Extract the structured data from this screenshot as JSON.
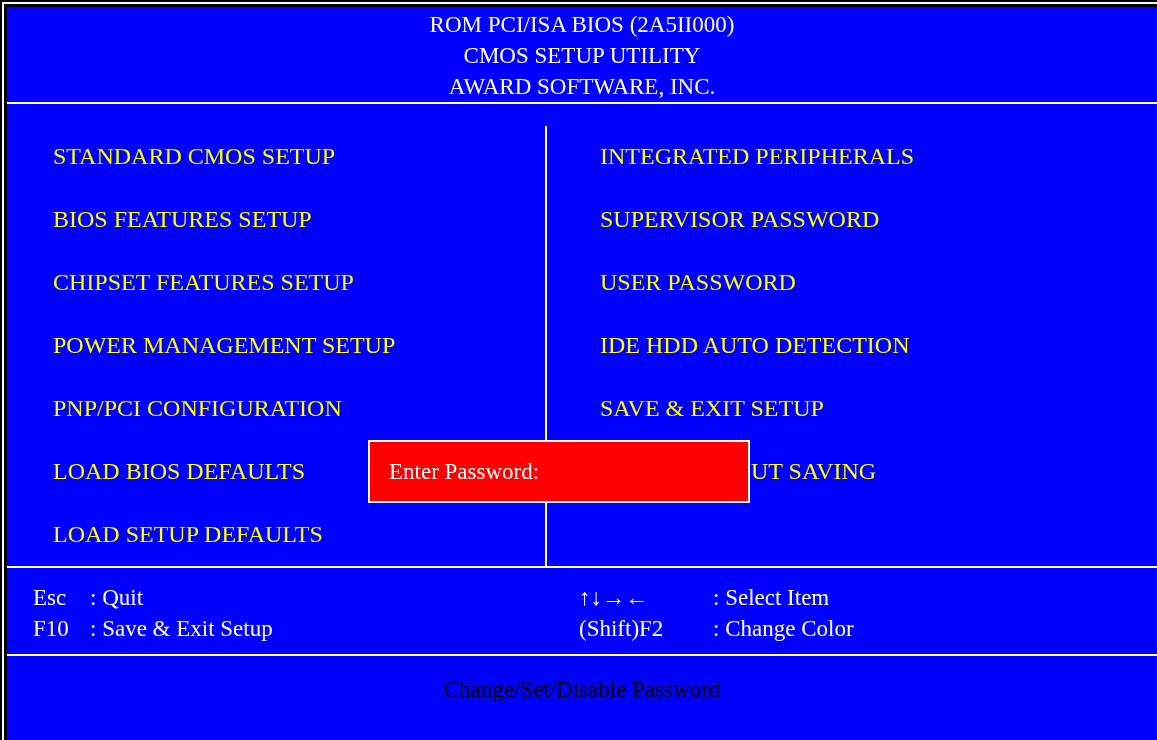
{
  "header": {
    "lines": [
      "ROM PCI/ISA BIOS (2A5II000)",
      "CMOS SETUP UTILITY",
      "AWARD SOFTWARE, INC."
    ]
  },
  "menu": {
    "left": [
      {
        "label": "STANDARD CMOS SETUP"
      },
      {
        "label": "BIOS FEATURES SETUP"
      },
      {
        "label": "CHIPSET FEATURES SETUP"
      },
      {
        "label": "POWER MANAGEMENT SETUP"
      },
      {
        "label": "PNP/PCI CONFIGURATION"
      },
      {
        "label": "LOAD BIOS DEFAULTS"
      },
      {
        "label": "LOAD SETUP DEFAULTS"
      }
    ],
    "right": [
      {
        "label": "INTEGRATED PERIPHERALS",
        "kind": "full"
      },
      {
        "label": "SUPERVISOR PASSWORD",
        "kind": "full"
      },
      {
        "label": "USER PASSWORD",
        "kind": "full"
      },
      {
        "label": "IDE HDD AUTO DETECTION",
        "kind": "full"
      },
      {
        "label": "SAVE & EXIT SETUP",
        "kind": "full"
      },
      {
        "label": "UT SAVING",
        "kind": "covered"
      }
    ]
  },
  "dialog": {
    "prompt": "Enter Password:"
  },
  "keys": {
    "left": [
      {
        "key": "Esc",
        "action": ": Quit"
      },
      {
        "key": "F10",
        "action": ": Save & Exit Setup"
      }
    ],
    "right": [
      {
        "key": "↑↓→←",
        "action": ": Select Item"
      },
      {
        "key": "(Shift)F2",
        "action": ": Change Color"
      }
    ]
  },
  "status": {
    "text": "Change/Set/Disable Password"
  }
}
